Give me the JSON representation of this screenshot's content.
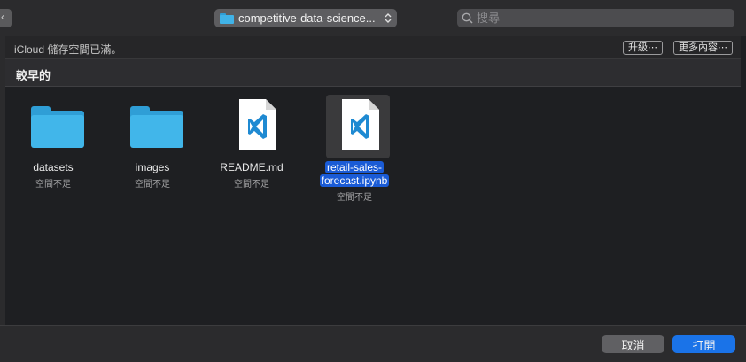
{
  "toolbar": {
    "left_stub_glyph": "‹",
    "path_label": "competitive-data-science...",
    "path_arrows": "⌃⌄",
    "search_placeholder": "搜尋"
  },
  "banner": {
    "message": "iCloud 儲存空間已滿。",
    "upgrade_label": "升級⋯",
    "more_label": "更多內容⋯"
  },
  "section": {
    "title": "較早的"
  },
  "files": [
    {
      "name": "datasets",
      "status": "空間不足",
      "kind": "folder"
    },
    {
      "name": "images",
      "status": "空間不足",
      "kind": "folder"
    },
    {
      "name": "README.md",
      "status": "空間不足",
      "kind": "vscode-document"
    },
    {
      "name_line1": "retail-sales-",
      "name_line2": "forecast.ipynb",
      "status": "空間不足",
      "kind": "vscode-document",
      "selected": true
    }
  ],
  "footer": {
    "cancel_label": "取消",
    "open_label": "打開"
  },
  "colors": {
    "accent": "#1a73e8",
    "selection": "#1a5bd6",
    "folder": "#41b6ea",
    "vscode": "#1f8ad2"
  }
}
